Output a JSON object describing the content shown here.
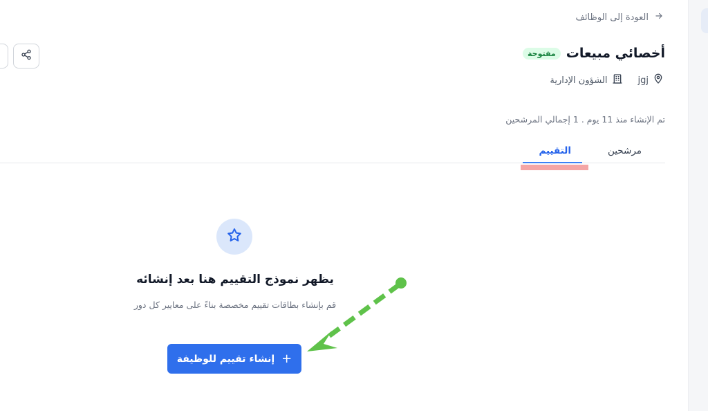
{
  "back": {
    "label": "العودة إلى الوظائف",
    "icon": "arrow-right-icon"
  },
  "job": {
    "title": "أخصائي مبيعات",
    "status": "مفتوحة",
    "location": "jgj",
    "department": "الشؤون الإدارية"
  },
  "created_info": "تم الإنشاء منذ 11 يوم . 1 إجمالي المرشحين",
  "tabs": [
    {
      "label": "مرشحين",
      "active": false
    },
    {
      "label": "التقييم",
      "active": true
    }
  ],
  "empty_state": {
    "icon": "star-icon",
    "title": "يظهر نموذج التقييم هنا بعد إنشائه",
    "description": "قم بإنشاء بطاقات تقييم مخصصة بناءً على معايير كل دور"
  },
  "create_button": {
    "label": "إنشاء تقييم للوظيفة",
    "icon": "+"
  },
  "colors": {
    "accent": "#2f6fec",
    "status_bg": "#dcfce7",
    "status_text": "#15803d",
    "annotation_arrow": "#5fc24a",
    "annotation_highlight": "#f4a6a6"
  }
}
